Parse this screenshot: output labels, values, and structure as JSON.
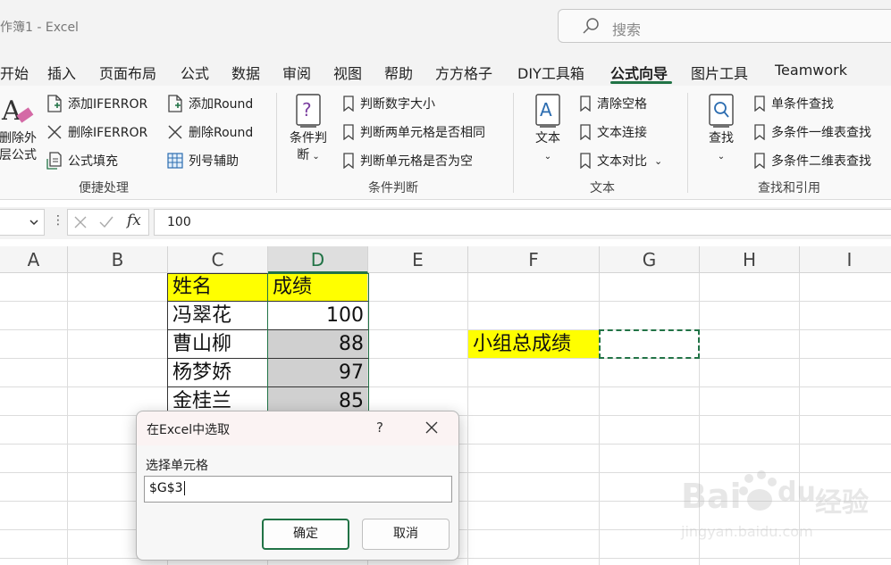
{
  "window": {
    "title": "作簿1 - Excel",
    "search_placeholder": "搜索"
  },
  "tabs": [
    {
      "label": "开始"
    },
    {
      "label": "插入"
    },
    {
      "label": "页面布局"
    },
    {
      "label": "公式"
    },
    {
      "label": "数据"
    },
    {
      "label": "审阅"
    },
    {
      "label": "视图"
    },
    {
      "label": "帮助"
    },
    {
      "label": "方方格子"
    },
    {
      "label": "DIY工具箱"
    },
    {
      "label": "公式向导",
      "active": true
    },
    {
      "label": "图片工具"
    },
    {
      "label": "Teamwork"
    }
  ],
  "ribbon": {
    "quick": {
      "big_label_1": "删除外",
      "big_label_2": "层公式",
      "add_iferror": "添加IFERROR",
      "del_iferror": "删除IFERROR",
      "formula_fill": "公式填充",
      "add_round": "添加Round",
      "del_round": "删除Round",
      "col_helper": "列号辅助",
      "group": "便捷处理"
    },
    "cond": {
      "big_label_1": "条件判",
      "big_label_2": "断",
      "num_size": "判断数字大小",
      "two_same": "判断两单元格是否相同",
      "empty": "判断单元格是否为空",
      "group": "条件判断"
    },
    "text": {
      "big_label": "文本",
      "clear_space": "清除空格",
      "concat": "文本连接",
      "compare": "文本对比",
      "group": "文本"
    },
    "lookup": {
      "big_label": "查找",
      "single": "单条件查找",
      "multi_1d": "多条件一维表查找",
      "multi_2d": "多条件二维表查找",
      "group": "查找和引用"
    }
  },
  "formula_bar": {
    "fx": "fx",
    "value": "100"
  },
  "columns": [
    "A",
    "B",
    "C",
    "D",
    "E",
    "F",
    "G",
    "H",
    "I"
  ],
  "sheet": {
    "header_name": "姓名",
    "header_score": "成绩",
    "rows": [
      {
        "name": "冯翠花",
        "score": "100"
      },
      {
        "name": "曹山柳",
        "score": "88"
      },
      {
        "name": "杨梦娇",
        "score": "97"
      },
      {
        "name": "金桂兰",
        "score": "85"
      }
    ],
    "group_total_label": "小组总成绩"
  },
  "dialog": {
    "title": "在Excel中选取",
    "help": "?",
    "label": "选择单元格",
    "value": "$G$3",
    "ok": "确定",
    "cancel": "取消"
  },
  "watermark": {
    "brand": "Bai",
    "brand2": "du",
    "cn": "经验",
    "url": "jingyan.baidu.com"
  },
  "colors": {
    "accent": "#217346",
    "highlight": "#ffff00",
    "selection": "#d0d0d0"
  }
}
